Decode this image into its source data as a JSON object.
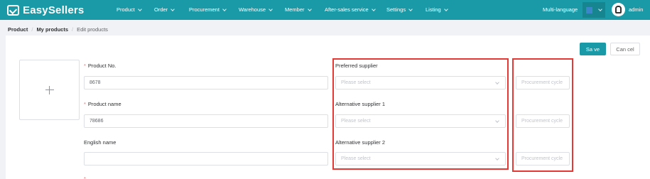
{
  "header": {
    "logo_text": "EasySellers",
    "nav": [
      {
        "label": "Product"
      },
      {
        "label": "Order"
      },
      {
        "label": "Procurement"
      },
      {
        "label": "Warehouse"
      },
      {
        "label": "Member"
      },
      {
        "label": "After-sales service"
      },
      {
        "label": "Settings"
      },
      {
        "label": "Listing"
      }
    ],
    "language_label": "Multi-language",
    "theme_color": "#3a86c8",
    "user_name": "admin"
  },
  "breadcrumb": [
    "Product",
    "My products",
    "Edit products"
  ],
  "actions": {
    "save_label": "Sa ve",
    "cancel_label": "Can cel"
  },
  "form": {
    "product_no": {
      "label": "Product No.",
      "value": "8678"
    },
    "product_name": {
      "label": "Product name",
      "value": "78686"
    },
    "english_name": {
      "label": "English name",
      "value": ""
    },
    "preferred_supplier": {
      "label": "Preferred supplier",
      "placeholder": "Please select"
    },
    "alt_supplier_1": {
      "label": "Alternative supplier 1",
      "placeholder": "Please select"
    },
    "alt_supplier_2": {
      "label": "Alternative supplier 2",
      "placeholder": "Please select"
    },
    "procurement_cycle_placeholder": "Procurement cycle"
  },
  "colors": {
    "brand": "#1a9aa7",
    "highlight": "#e53935",
    "required": "#f56c6c"
  }
}
